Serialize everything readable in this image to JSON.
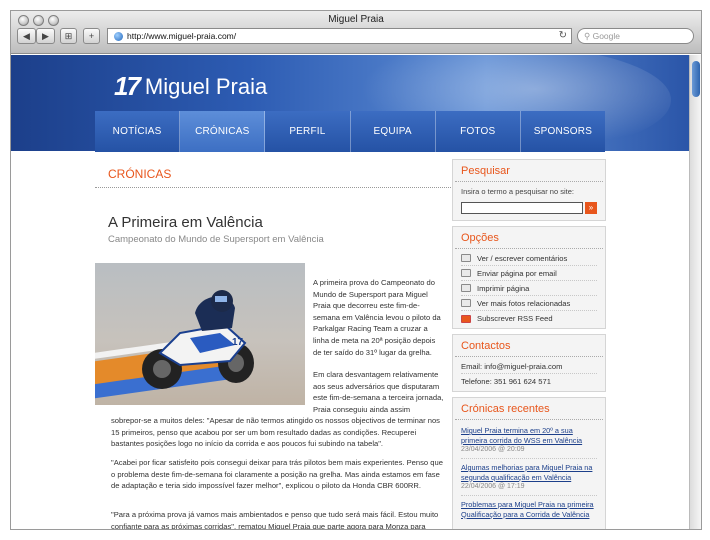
{
  "window": {
    "title": "Miguel Praia",
    "url": "http://www.miguel-praia.com/",
    "search_placeholder": "Google",
    "back_label": "◀",
    "forward_label": "▶",
    "reload_label": "↻"
  },
  "site": {
    "logo_mark": "17",
    "logo_text": "Miguel Praia"
  },
  "nav": [
    "NOTÍCIAS",
    "CRÓNICAS",
    "PERFIL",
    "EQUIPA",
    "FOTOS",
    "SPONSORS"
  ],
  "nav_active": "CRÓNICAS",
  "main": {
    "section_title": "CRÓNICAS",
    "article_title": "A Primeira em Valência",
    "article_subtitle": "Campeonato do Mundo de Supersport em Valência",
    "p1": "A primeira prova do Campeonato do Mundo de Supersport para Miguel Praia que decorreu este fim-de-semana em Valência levou o piloto da Parkalgar Racing Team a cruzar a linha de meta na 20ª posição depois de ter saído do 31º lugar da grelha.",
    "p2a": "Em clara desvantagem relativamente aos seus adversários que disputaram este fim-de-semana a terceira jornada, Praia conseguiu ainda assim",
    "p2b": "sobrepor-se a muitos deles: \"Apesar de não termos atingido os nossos objectivos de terminar nos 15 primeiros, penso que acabou por ser um bom resultado dadas as condições. Recuperei bastantes posições logo no início da corrida e aos poucos fui subindo na tabela\".",
    "p3": "\"Acabei por ficar satisfeito pois consegui deixar para trás pilotos bem mais experientes. Penso que o problema deste fim-de-semana foi claramente a posição na grelha. Mas ainda estamos em fase de adaptação e teria sido impossível fazer melhor\", explicou o piloto da Honda CBR 600RR.",
    "p4": "\"Para a próxima prova já vamos mais ambientados e penso que tudo será mais fácil. Estou muito confiante para as próximas corridas\", rematou Miguel Praia que parte agora para Monza para"
  },
  "sidebar": {
    "search": {
      "title": "Pesquisar",
      "label": "Insira o termo a pesquisar no site:",
      "go": "»"
    },
    "options": {
      "title": "Opções",
      "items": [
        {
          "label": "Ver / escrever comentários",
          "icon": "comment-icon"
        },
        {
          "label": "Enviar página  por email",
          "icon": "email-icon"
        },
        {
          "label": "Imprimir página",
          "icon": "print-icon"
        },
        {
          "label": "Ver mais fotos relacionadas",
          "icon": "camera-icon"
        },
        {
          "label": "Subscrever RSS Feed",
          "icon": "rss-icon"
        }
      ]
    },
    "contacts": {
      "title": "Contactos",
      "email": "Email: info@miguel-praia.com",
      "phone": "Telefone: 351 961 624 571"
    },
    "recent": {
      "title": "Crónicas recentes",
      "items": [
        {
          "title": "Miguel Praia termina em 20º a sua primeira corrida do WSS em Valência",
          "date": "23/04/2006 @ 20:09"
        },
        {
          "title": "Algumas melhorias para Miguel Praia na segunda qualificação em Valência",
          "date": "22/04/2006 @ 17:19"
        },
        {
          "title": "Problemas para Miguel Praia na primeira Qualificação para a Corrida de Valência",
          "date": ""
        }
      ]
    }
  }
}
